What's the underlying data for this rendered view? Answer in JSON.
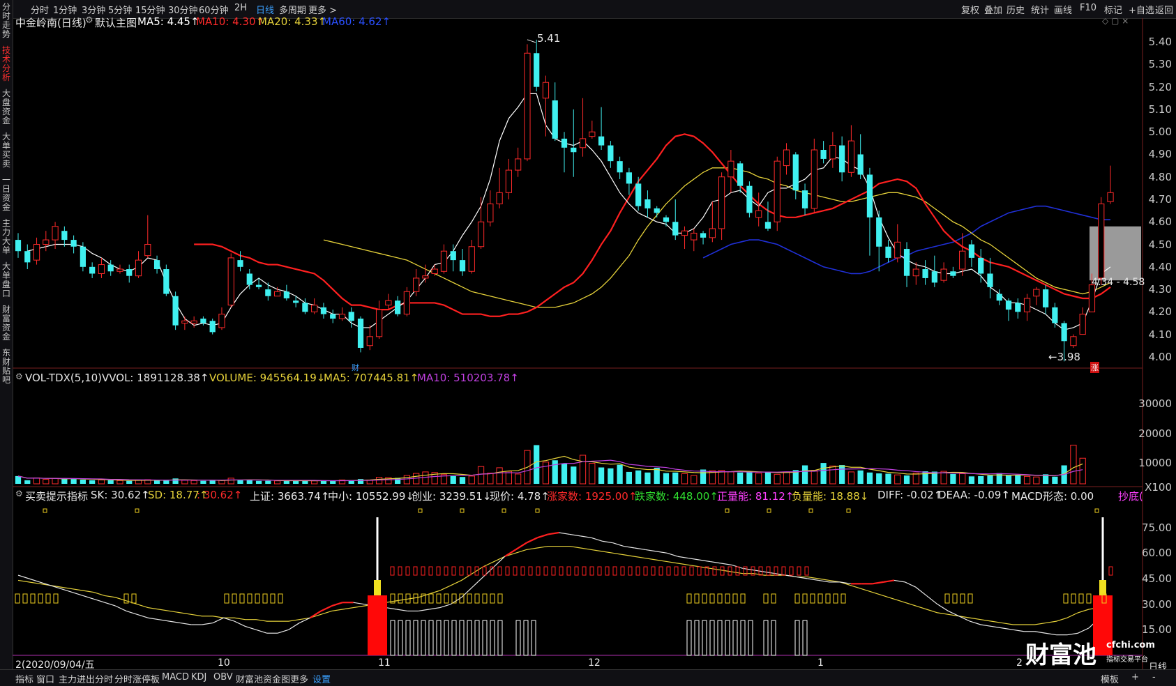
{
  "toolbar": {
    "left": [
      "分时",
      "1分钟",
      "3分钟",
      "5分钟",
      "15分钟",
      "30分钟",
      "60分钟",
      "2H",
      "日线",
      "多周期",
      "更多 >"
    ],
    "active": "日线",
    "right": [
      "复权",
      "叠加",
      "历史",
      "统计",
      "画线",
      "F10",
      "标记",
      "+自选",
      "返回"
    ]
  },
  "sidebar_tabs": [
    "分时走势",
    "技术分析",
    "大盘资金",
    "大单买卖",
    "一日资金",
    "主力大单",
    "大单盘口",
    "财富资金",
    "东财贴吧"
  ],
  "sidebar_active": "技术分析",
  "price_header": {
    "stock": "中金岭南(日线)",
    "main": "默认主图",
    "ma5": "MA5: 4.45↑",
    "ma10": "MA10: 4.30↑",
    "ma20": "MA20: 4.33↑",
    "ma60": "MA60: 4.62↑"
  },
  "price_axis": [
    "5.40",
    "5.30",
    "5.20",
    "5.10",
    "5.00",
    "4.90",
    "4.80",
    "4.70",
    "4.60",
    "4.50",
    "4.40",
    "4.30",
    "4.20",
    "4.10",
    "4.00"
  ],
  "annotations": {
    "high": "5.41",
    "low": "←3.98",
    "range": "4.34 - 4.58",
    "cai": "财",
    "zhang": "涨"
  },
  "vol_header": {
    "name": "VOL-TDX(5,10)",
    "vvol": "VVOL: 1891128.38↑",
    "volume": "VOLUME: 945564.19↓",
    "ma5": "MA5: 707445.81↑",
    "ma10": "MA10: 510203.78↑"
  },
  "vol_axis": [
    "30000",
    "20000",
    "10000",
    "X100"
  ],
  "ind_header": {
    "name": "买卖提示指标",
    "sk": "SK: 30.62↑",
    "sd": "SD: 18.77↑",
    "x": ": 30.62↑",
    "sh": "上证: 3663.74↑",
    "zx": "中小: 10552.99↓",
    "cy": "创业: 3239.51↓",
    "price": "现价: 4.78↑",
    "up": "涨家数: 1925.00↑",
    "down": "跌家数: 448.00↑",
    "pos": "正量能: 81.12↑",
    "neg": "负量能: 18.88↓",
    "diff": "DIFF: -0.02↑",
    "deaa": "DEAA: -0.09↑",
    "macd": "MACD形态: 0.00",
    "chaodi": "抄底(",
    "abovefade": ""
  },
  "ind_axis": [
    "75.00",
    "60.00",
    "45.00",
    "30.00",
    "15.00"
  ],
  "date_axis": {
    "start": "2(2020/09/04/五",
    "m10": "10",
    "m11": "11",
    "m12": "12",
    "m1": "1",
    "m2": "2",
    "right": "日线"
  },
  "bottombar": {
    "items": [
      "指标",
      "窗口",
      "主力进出分时",
      "分时涨停板",
      "MACD",
      "KDJ",
      "OBV",
      "财富池资金图",
      "更多",
      "设置"
    ],
    "active": "设置",
    "right": [
      "模板",
      "+",
      "-"
    ]
  },
  "watermark": {
    "brand": "财富池",
    "site": "cfchi.com",
    "tag": "指标交易平台"
  },
  "colors": {
    "up": "#ff2a2a",
    "down": "#40f0f0",
    "ma5": "#ffffff",
    "ma10": "#ff2020",
    "ma20": "#e6d23a",
    "ma60": "#2030d8",
    "blue": "#3aa0ff"
  },
  "chart_data": {
    "type": "candlestick",
    "price_ylim": [
      3.95,
      5.45
    ],
    "candles": [
      [
        4.52,
        4.47,
        4.55,
        4.44
      ],
      [
        4.47,
        4.42,
        4.5,
        4.39
      ],
      [
        4.43,
        4.5,
        4.53,
        4.41
      ],
      [
        4.5,
        4.52,
        4.56,
        4.47
      ],
      [
        4.52,
        4.58,
        4.6,
        4.48
      ],
      [
        4.56,
        4.52,
        4.58,
        4.49
      ],
      [
        4.52,
        4.49,
        4.54,
        4.46
      ],
      [
        4.49,
        4.4,
        4.51,
        4.38
      ],
      [
        4.4,
        4.37,
        4.42,
        4.35
      ],
      [
        4.37,
        4.41,
        4.44,
        4.35
      ],
      [
        4.41,
        4.38,
        4.43,
        4.36
      ],
      [
        4.38,
        4.39,
        4.41,
        4.37
      ],
      [
        4.39,
        4.36,
        4.41,
        4.33
      ],
      [
        4.36,
        4.43,
        4.47,
        4.35
      ],
      [
        4.45,
        4.5,
        4.63,
        4.44
      ],
      [
        4.43,
        4.39,
        4.45,
        4.37
      ],
      [
        4.39,
        4.28,
        4.41,
        4.27
      ],
      [
        4.27,
        4.14,
        4.29,
        4.12
      ],
      [
        4.15,
        4.16,
        4.18,
        4.12
      ],
      [
        4.15,
        4.16,
        4.18,
        4.13
      ],
      [
        4.17,
        4.15,
        4.18,
        4.14
      ],
      [
        4.16,
        4.11,
        4.17,
        4.1
      ],
      [
        4.13,
        4.19,
        4.22,
        4.12
      ],
      [
        4.23,
        4.44,
        4.46,
        4.22
      ],
      [
        4.43,
        4.4,
        4.47,
        4.38
      ],
      [
        4.37,
        4.32,
        4.39,
        4.3
      ],
      [
        4.32,
        4.31,
        4.35,
        4.3
      ],
      [
        4.3,
        4.27,
        4.33,
        4.25
      ],
      [
        4.27,
        4.29,
        4.31,
        4.27
      ],
      [
        4.29,
        4.26,
        4.32,
        4.25
      ],
      [
        4.25,
        4.24,
        4.27,
        4.22
      ],
      [
        4.24,
        4.2,
        4.26,
        4.19
      ],
      [
        4.2,
        4.23,
        4.26,
        4.19
      ],
      [
        4.22,
        4.19,
        4.24,
        4.17
      ],
      [
        4.19,
        4.17,
        4.21,
        4.15
      ],
      [
        4.17,
        4.19,
        4.22,
        4.16
      ],
      [
        4.2,
        4.16,
        4.22,
        4.13
      ],
      [
        4.17,
        4.04,
        4.18,
        4.02
      ],
      [
        4.05,
        4.09,
        4.14,
        4.03
      ],
      [
        4.09,
        4.21,
        4.25,
        4.08
      ],
      [
        4.23,
        4.25,
        4.28,
        4.21
      ],
      [
        4.25,
        4.19,
        4.27,
        4.18
      ],
      [
        4.19,
        4.29,
        4.31,
        4.18
      ],
      [
        4.29,
        4.35,
        4.39,
        4.27
      ],
      [
        4.35,
        4.36,
        4.41,
        4.33
      ],
      [
        4.37,
        4.39,
        4.41,
        4.36
      ],
      [
        4.38,
        4.47,
        4.5,
        4.37
      ],
      [
        4.47,
        4.43,
        4.5,
        4.38
      ],
      [
        4.43,
        4.38,
        4.48,
        4.36
      ],
      [
        4.38,
        4.49,
        4.52,
        4.37
      ],
      [
        4.49,
        4.6,
        4.71,
        4.48
      ],
      [
        4.6,
        4.68,
        4.74,
        4.58
      ],
      [
        4.68,
        4.73,
        4.84,
        4.66
      ],
      [
        4.73,
        4.83,
        4.88,
        4.7
      ],
      [
        4.83,
        4.88,
        4.93,
        4.8
      ],
      [
        4.88,
        5.35,
        5.39,
        4.87
      ],
      [
        5.35,
        5.2,
        5.41,
        5.18
      ],
      [
        5.15,
        5.22,
        5.25,
        4.98
      ],
      [
        5.14,
        4.97,
        5.22,
        4.96
      ],
      [
        4.97,
        4.93,
        5.0,
        4.82
      ],
      [
        4.93,
        4.91,
        5.1,
        4.8
      ],
      [
        4.93,
        4.97,
        5.15,
        4.89
      ],
      [
        4.98,
        5.0,
        5.05,
        4.97
      ],
      [
        4.98,
        4.94,
        5.11,
        4.92
      ],
      [
        4.94,
        4.87,
        4.96,
        4.84
      ],
      [
        4.87,
        4.82,
        4.89,
        4.79
      ],
      [
        4.82,
        4.77,
        4.84,
        4.72
      ],
      [
        4.77,
        4.67,
        4.8,
        4.65
      ],
      [
        4.7,
        4.66,
        4.74,
        4.62
      ],
      [
        4.66,
        4.64,
        4.67,
        4.62
      ],
      [
        4.62,
        4.6,
        4.63,
        4.58
      ],
      [
        4.6,
        4.54,
        4.7,
        4.52
      ],
      [
        4.54,
        4.56,
        4.58,
        4.48
      ],
      [
        4.52,
        4.55,
        4.57,
        4.47
      ],
      [
        4.55,
        4.53,
        4.56,
        4.5
      ],
      [
        4.53,
        4.57,
        4.69,
        4.51
      ],
      [
        4.57,
        4.8,
        4.82,
        4.52
      ],
      [
        4.8,
        4.87,
        4.92,
        4.73
      ],
      [
        4.86,
        4.76,
        4.87,
        4.73
      ],
      [
        4.76,
        4.64,
        4.78,
        4.62
      ],
      [
        4.62,
        4.65,
        4.73,
        4.58
      ],
      [
        4.6,
        4.57,
        4.69,
        4.56
      ],
      [
        4.6,
        4.87,
        4.89,
        4.56
      ],
      [
        4.85,
        4.92,
        4.95,
        4.81
      ],
      [
        4.9,
        4.74,
        4.91,
        4.7
      ],
      [
        4.74,
        4.66,
        4.77,
        4.63
      ],
      [
        4.66,
        4.92,
        4.97,
        4.64
      ],
      [
        4.92,
        4.88,
        4.96,
        4.86
      ],
      [
        4.88,
        4.94,
        5.0,
        4.84
      ],
      [
        4.94,
        4.82,
        4.98,
        4.78
      ],
      [
        4.82,
        4.96,
        5.03,
        4.8
      ],
      [
        4.9,
        4.81,
        4.99,
        4.79
      ],
      [
        4.81,
        4.62,
        4.84,
        4.45
      ],
      [
        4.62,
        4.49,
        4.65,
        4.38
      ],
      [
        4.49,
        4.44,
        4.52,
        4.42
      ],
      [
        4.44,
        4.51,
        4.59,
        4.42
      ],
      [
        4.48,
        4.36,
        4.51,
        4.31
      ],
      [
        4.36,
        4.39,
        4.42,
        4.32
      ],
      [
        4.39,
        4.35,
        4.43,
        4.32
      ],
      [
        4.38,
        4.33,
        4.45,
        4.31
      ],
      [
        4.34,
        4.39,
        4.42,
        4.33
      ],
      [
        4.38,
        4.36,
        4.4,
        4.35
      ],
      [
        4.39,
        4.47,
        4.55,
        4.36
      ],
      [
        4.5,
        4.44,
        4.52,
        4.4
      ],
      [
        4.44,
        4.37,
        4.48,
        4.33
      ],
      [
        4.37,
        4.31,
        4.44,
        4.26
      ],
      [
        4.28,
        4.25,
        4.3,
        4.23
      ],
      [
        4.25,
        4.21,
        4.26,
        4.16
      ],
      [
        4.24,
        4.2,
        4.26,
        4.17
      ],
      [
        4.2,
        4.26,
        4.28,
        4.16
      ],
      [
        4.27,
        4.3,
        4.31,
        4.23
      ],
      [
        4.3,
        4.22,
        4.32,
        4.19
      ],
      [
        4.22,
        4.15,
        4.24,
        4.13
      ],
      [
        4.15,
        4.07,
        4.16,
        3.98
      ],
      [
        4.05,
        4.09,
        4.1,
        4.04
      ],
      [
        4.1,
        4.19,
        4.22,
        4.1
      ],
      [
        4.2,
        4.32,
        4.37,
        4.2
      ],
      [
        4.35,
        4.68,
        4.71,
        4.32
      ],
      [
        4.69,
        4.73,
        4.85,
        4.68
      ]
    ],
    "ma5": [
      4.47,
      4.48,
      4.49,
      4.5,
      4.5,
      4.5,
      4.49,
      4.46,
      4.44,
      4.41,
      4.39,
      4.38,
      4.4,
      4.44,
      4.43,
      4.33,
      4.24,
      4.17,
      4.14,
      4.15,
      4.14,
      4.15,
      4.22,
      4.28,
      4.32,
      4.35,
      4.32,
      4.3,
      4.29,
      4.27,
      4.24,
      4.23,
      4.21,
      4.19,
      4.19,
      4.15,
      4.13,
      4.13,
      4.16,
      4.19,
      4.22,
      4.25,
      4.3,
      4.35,
      4.41,
      4.42,
      4.47,
      4.54,
      4.6,
      4.67,
      4.79,
      4.96,
      5.06,
      5.11,
      5.17,
      5.17,
      5.03,
      4.97,
      4.95,
      4.94,
      4.96,
      4.92,
      4.87,
      4.8,
      4.73,
      4.68,
      4.64,
      4.62,
      4.6,
      4.59,
      4.55,
      4.55,
      4.57,
      4.62,
      4.69,
      4.7,
      4.73,
      4.74,
      4.7,
      4.67,
      4.73,
      4.75,
      4.75,
      4.77,
      4.79,
      4.83,
      4.84,
      4.89,
      4.88,
      4.85,
      4.83,
      4.75,
      4.62,
      4.53,
      4.46,
      4.43,
      4.41,
      4.4,
      4.38,
      4.37,
      4.37,
      4.38,
      4.39,
      4.36,
      4.31,
      4.28,
      4.24,
      4.24,
      4.23,
      4.21,
      4.19,
      4.15,
      4.12,
      4.13,
      4.15,
      4.25,
      4.37,
      4.4
    ],
    "ma10": [
      4.5,
      4.5,
      4.5,
      4.49,
      4.47,
      4.45,
      4.44,
      4.42,
      4.41,
      4.41,
      4.4,
      4.39,
      4.38,
      4.37,
      4.34,
      4.3,
      4.26,
      4.23,
      4.23,
      4.22,
      4.21,
      4.21,
      4.23,
      4.24,
      4.24,
      4.24,
      4.24,
      4.23,
      4.21,
      4.19,
      4.19,
      4.19,
      4.18,
      4.18,
      4.19,
      4.19,
      4.2,
      4.22,
      4.25,
      4.28,
      4.31,
      4.33,
      4.37,
      4.43,
      4.5,
      4.56,
      4.64,
      4.71,
      4.78,
      4.83,
      4.88,
      4.94,
      4.98,
      4.99,
      4.98,
      4.95,
      4.91,
      4.86,
      4.81,
      4.76,
      4.72,
      4.68,
      4.65,
      4.63,
      4.62,
      4.62,
      4.63,
      4.64,
      4.65,
      4.66,
      4.68,
      4.7,
      4.72,
      4.74,
      4.77,
      4.78,
      4.79,
      4.78,
      4.75,
      4.68,
      4.62,
      4.56,
      4.52,
      4.49,
      4.47,
      4.44,
      4.42,
      4.41,
      4.4,
      4.38,
      4.36,
      4.34,
      4.32,
      4.3,
      4.28,
      4.27,
      4.26,
      4.26,
      4.28,
      4.31
    ],
    "ma20": [
      4.52,
      4.51,
      4.5,
      4.49,
      4.48,
      4.47,
      4.46,
      4.45,
      4.44,
      4.43,
      4.41,
      4.39,
      4.37,
      4.35,
      4.33,
      4.31,
      4.29,
      4.28,
      4.27,
      4.26,
      4.25,
      4.24,
      4.23,
      4.22,
      4.22,
      4.22,
      4.23,
      4.24,
      4.26,
      4.28,
      4.31,
      4.35,
      4.4,
      4.45,
      4.52,
      4.58,
      4.63,
      4.68,
      4.72,
      4.76,
      4.79,
      4.82,
      4.84,
      4.84,
      4.84,
      4.83,
      4.82,
      4.8,
      4.79,
      4.77,
      4.76,
      4.74,
      4.73,
      4.72,
      4.71,
      4.7,
      4.69,
      4.69,
      4.7,
      4.71,
      4.72,
      4.73,
      4.73,
      4.72,
      4.71,
      4.69,
      4.66,
      4.63,
      4.6,
      4.58,
      4.55,
      4.52,
      4.5,
      4.47,
      4.44,
      4.41,
      4.38,
      4.35,
      4.33,
      4.31,
      4.3,
      4.29,
      4.28,
      4.29,
      4.31,
      4.33
    ],
    "ma60": [
      4.44,
      4.46,
      4.48,
      4.5,
      4.51,
      4.52,
      4.52,
      4.51,
      4.5,
      4.48,
      4.46,
      4.44,
      4.42,
      4.4,
      4.39,
      4.38,
      4.37,
      4.37,
      4.38,
      4.4,
      4.42,
      4.44,
      4.45,
      4.47,
      4.48,
      4.49,
      4.5,
      4.51,
      4.53,
      4.55,
      4.58,
      4.6,
      4.62,
      4.64,
      4.65,
      4.66,
      4.67,
      4.67,
      4.66,
      4.65,
      4.64,
      4.63,
      4.62,
      4.61,
      4.61
    ],
    "volume": [
      26,
      12,
      20,
      15,
      18,
      18,
      16,
      14,
      12,
      13,
      12,
      11,
      10,
      12,
      14,
      13,
      11,
      18,
      12,
      11,
      10,
      11,
      12,
      19,
      13,
      12,
      10,
      10,
      10,
      11,
      11,
      11,
      10,
      10,
      10,
      13,
      12,
      16,
      13,
      22,
      21,
      20,
      28,
      35,
      40,
      38,
      31,
      26,
      23,
      26,
      58,
      36,
      54,
      42,
      33,
      112,
      130,
      73,
      79,
      68,
      58,
      96,
      69,
      55,
      52,
      64,
      40,
      45,
      38,
      54,
      36,
      38,
      34,
      28,
      48,
      44,
      45,
      40,
      38,
      42,
      36,
      40,
      32,
      40,
      46,
      62,
      45,
      70,
      60,
      63,
      40,
      45,
      38,
      35,
      34,
      30,
      28,
      36,
      42,
      41,
      42,
      33,
      34,
      25,
      26,
      28,
      36,
      28,
      30,
      25,
      23,
      32,
      24,
      62,
      130,
      86
    ],
    "vol_ylim": [
      0,
      330
    ],
    "sk": [
      47,
      45,
      43,
      41,
      39,
      37,
      35,
      33,
      31,
      29,
      26,
      24,
      22,
      21,
      20,
      19,
      18,
      18,
      19,
      22,
      20,
      17,
      15,
      13,
      13,
      15,
      19,
      22,
      26,
      29,
      31,
      31,
      30,
      29,
      28,
      27,
      26,
      26,
      27,
      28,
      30,
      34,
      40,
      46,
      52,
      58,
      62,
      66,
      69,
      71,
      72,
      71,
      70,
      69,
      67,
      66,
      64,
      63,
      62,
      61,
      60,
      58,
      57,
      56,
      55,
      54,
      53,
      51,
      50,
      49,
      48,
      47,
      46,
      45,
      44,
      43,
      43,
      42,
      42,
      42,
      43,
      44,
      43,
      40,
      35,
      30,
      26,
      23,
      20,
      18,
      17,
      16,
      15,
      14,
      14,
      13,
      12,
      12,
      13,
      16,
      22,
      30
    ],
    "sd": [
      44,
      43,
      42,
      41,
      40,
      39,
      38,
      37,
      35,
      34,
      32,
      30,
      28,
      27,
      26,
      25,
      24,
      23,
      23,
      22,
      22,
      21,
      21,
      20,
      20,
      20,
      21,
      22,
      24,
      26,
      27,
      28,
      29,
      30,
      31,
      32,
      33,
      34,
      36,
      38,
      41,
      44,
      48,
      52,
      55,
      58,
      60,
      62,
      63,
      64,
      64,
      64,
      63,
      62,
      61,
      60,
      59,
      58,
      57,
      56,
      55,
      54,
      53,
      52,
      51,
      50,
      49,
      48,
      48,
      47,
      47,
      47,
      46,
      46,
      45,
      44,
      43,
      41,
      39,
      37,
      35,
      33,
      31,
      29,
      27,
      25,
      24,
      23,
      22,
      21,
      20,
      19,
      18,
      18,
      18,
      19,
      20,
      22,
      25,
      27,
      28,
      28
    ],
    "ind_ylim": [
      0,
      90
    ]
  }
}
